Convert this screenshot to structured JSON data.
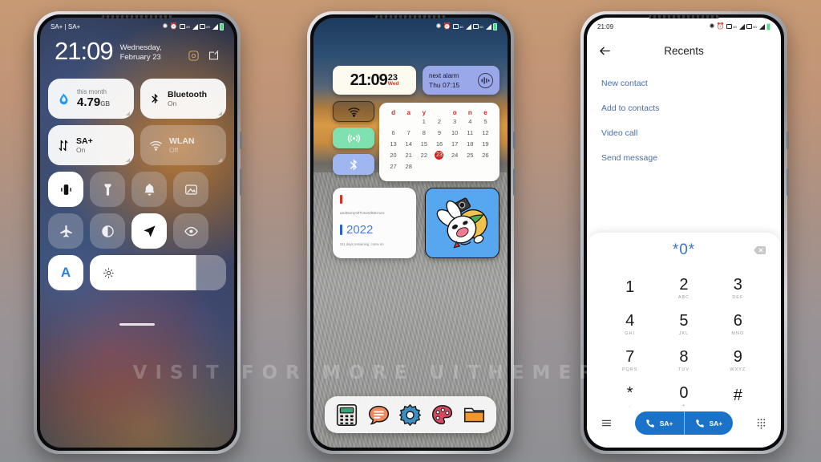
{
  "watermark": "VISIT FOR MORE  UITHEMER.COM",
  "phone1": {
    "name": "control-center",
    "statusbar": {
      "left": "SA+ | SA+",
      "time": "",
      "icons": [
        "bluetooth-icon",
        "alarm-icon",
        "sim1-icon",
        "signal1-icon",
        "sim2-icon",
        "signal2-icon",
        "battery-icon"
      ]
    },
    "clock": {
      "time": "21:09",
      "date": "Wednesday, February 23"
    },
    "actions": [
      "settings-gear-icon",
      "edit-icon"
    ],
    "tiles_big": [
      {
        "name": "data-usage",
        "icon": "water-drop-icon",
        "label_small": "this month",
        "value": "4.79",
        "unit": "GB",
        "state": "on"
      },
      {
        "name": "bluetooth",
        "icon": "bluetooth-icon",
        "title": "Bluetooth",
        "sub": "On",
        "state": "on"
      },
      {
        "name": "mobile-data",
        "icon": "data-arrows-icon",
        "title": "SA+",
        "sub": "On",
        "state": "on"
      },
      {
        "name": "wlan",
        "icon": "wifi-icon",
        "title": "WLAN",
        "sub": "Off",
        "state": "off"
      }
    ],
    "tiles_small": [
      {
        "name": "vibrate",
        "icon": "vibrate-icon",
        "state": "on"
      },
      {
        "name": "flashlight",
        "icon": "flashlight-icon",
        "state": "off"
      },
      {
        "name": "ringer",
        "icon": "bell-icon",
        "state": "off"
      },
      {
        "name": "screenshot",
        "icon": "screenshot-icon",
        "state": "off"
      },
      {
        "name": "airplane-mode",
        "icon": "airplane-icon",
        "state": "off"
      },
      {
        "name": "dark-mode",
        "icon": "contrast-icon",
        "state": "off"
      },
      {
        "name": "location",
        "icon": "location-arrow-icon",
        "state": "on"
      },
      {
        "name": "eye-comfort",
        "icon": "eye-icon",
        "state": "off"
      }
    ],
    "brightness": {
      "auto_label": "A",
      "icon": "sun-icon",
      "level": 78
    }
  },
  "phone2": {
    "name": "home-screen",
    "statusbar": {
      "icons": [
        "bluetooth-icon",
        "alarm-icon",
        "sim1-icon",
        "signal1-icon",
        "sim2-icon",
        "signal2-icon",
        "battery-icon"
      ]
    },
    "clock_widget": {
      "time": "21:09",
      "day_num": "23",
      "weekday": "Wed"
    },
    "alarm_widget": {
      "title": "next alarm",
      "value": "Thu 07:15",
      "icon": "alarm-waveform-icon"
    },
    "toggles": [
      {
        "name": "wifi",
        "icon": "wifi-icon",
        "color": "#2a2622"
      },
      {
        "name": "hotspot",
        "icon": "hotspot-icon",
        "color": "#7fe0b0"
      },
      {
        "name": "bluetooth",
        "icon": "bluetooth-icon",
        "color": "#9fb6f0"
      }
    ],
    "calendar": {
      "headers": [
        "d",
        "a",
        "y",
        "",
        "o",
        "n",
        "e"
      ],
      "weeks": [
        [
          "",
          "",
          "1",
          "2",
          "3",
          "4",
          "5"
        ],
        [
          "6",
          "7",
          "8",
          "9",
          "10",
          "11",
          "12"
        ],
        [
          "13",
          "14",
          "15",
          "16",
          "17",
          "18",
          "19"
        ],
        [
          "20",
          "21",
          "22",
          "23",
          "24",
          "25",
          "26"
        ],
        [
          "27",
          "28",
          "",
          "",
          "",
          "",
          ""
        ]
      ],
      "today": "23"
    },
    "note_widget": {
      "title": "andDeityOfTimeOfMirrors",
      "year": "2022",
      "sub": "311 days remaining, come on"
    },
    "photo_widget": {
      "name": "rabbit-sticker"
    },
    "dock": [
      {
        "name": "calculator",
        "icon": "calculator-icon"
      },
      {
        "name": "messages",
        "icon": "message-bubble-icon"
      },
      {
        "name": "settings",
        "icon": "gear-icon"
      },
      {
        "name": "themes",
        "icon": "palette-icon"
      },
      {
        "name": "file-manager",
        "icon": "folder-icon"
      }
    ]
  },
  "phone3": {
    "name": "dialer",
    "statusbar": {
      "time": "21:09",
      "icons": [
        "bluetooth-icon",
        "alarm-icon",
        "sim1-icon",
        "signal1-icon",
        "sim2-icon",
        "signal2-icon",
        "battery-icon"
      ]
    },
    "title": "Recents",
    "back_icon": "back-arrow-icon",
    "menu": [
      "New contact",
      "Add to contacts",
      "Video call",
      "Send message"
    ],
    "dial_value": "*0*",
    "backspace_icon": "backspace-icon",
    "keys": [
      {
        "num": "1",
        "letters": ""
      },
      {
        "num": "2",
        "letters": "ABC"
      },
      {
        "num": "3",
        "letters": "DEF"
      },
      {
        "num": "4",
        "letters": "GHI"
      },
      {
        "num": "5",
        "letters": "JKL"
      },
      {
        "num": "6",
        "letters": "MNO"
      },
      {
        "num": "7",
        "letters": "PQRS"
      },
      {
        "num": "8",
        "letters": "TUV"
      },
      {
        "num": "9",
        "letters": "WXYZ"
      },
      {
        "num": "*",
        "letters": ","
      },
      {
        "num": "0",
        "letters": "+"
      },
      {
        "num": "#",
        "letters": ""
      }
    ],
    "bottom": {
      "menu_icon": "hamburger-icon",
      "call1_label": "SA+",
      "call2_label": "SA+",
      "keypad_icon": "keypad-icon",
      "accent": "#1a73c8"
    }
  }
}
